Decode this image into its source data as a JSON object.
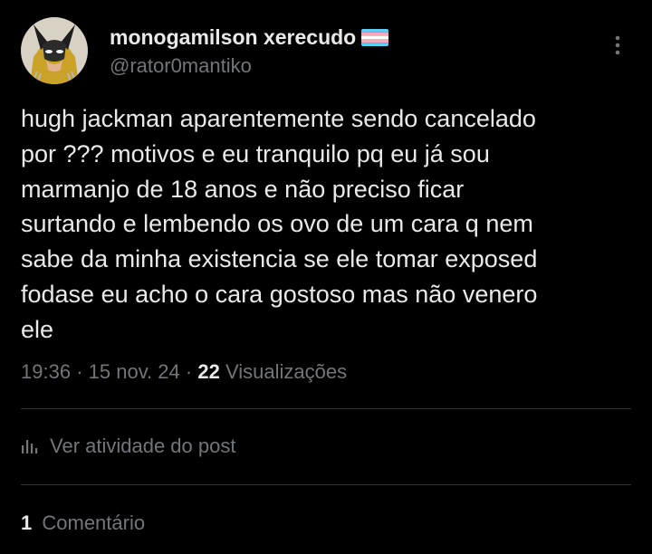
{
  "author": {
    "display_name": "monogamilson xerecudo",
    "handle": "@rator0mantiko",
    "avatar_icon": "avatar-wolverine-icon",
    "flag_icon": "transgender-flag-icon"
  },
  "tweet": {
    "text": "hugh jackman aparentemente sendo cancelado\npor ??? motivos e eu tranquilo pq eu já sou\nmarmanjo de 18 anos e não preciso ficar\nsurtando e lembendo os ovo de um cara q nem\nsabe da minha existencia se ele tomar exposed\nfodase eu acho o cara gostoso mas não venero\nele",
    "time": "19:36",
    "date": "15 nov. 24",
    "separator": "·",
    "views_count": "22",
    "views_label": "Visualizações"
  },
  "actions": {
    "activity_label": "Ver atividade do post",
    "activity_icon": "bar-chart-icon",
    "more_icon": "more-vertical-icon"
  },
  "replies": {
    "count": "1",
    "label": "Comentário"
  },
  "colors": {
    "background": "#000000",
    "primary_text": "#e7e9ea",
    "secondary_text": "#71767b",
    "divider": "#2f3336"
  }
}
